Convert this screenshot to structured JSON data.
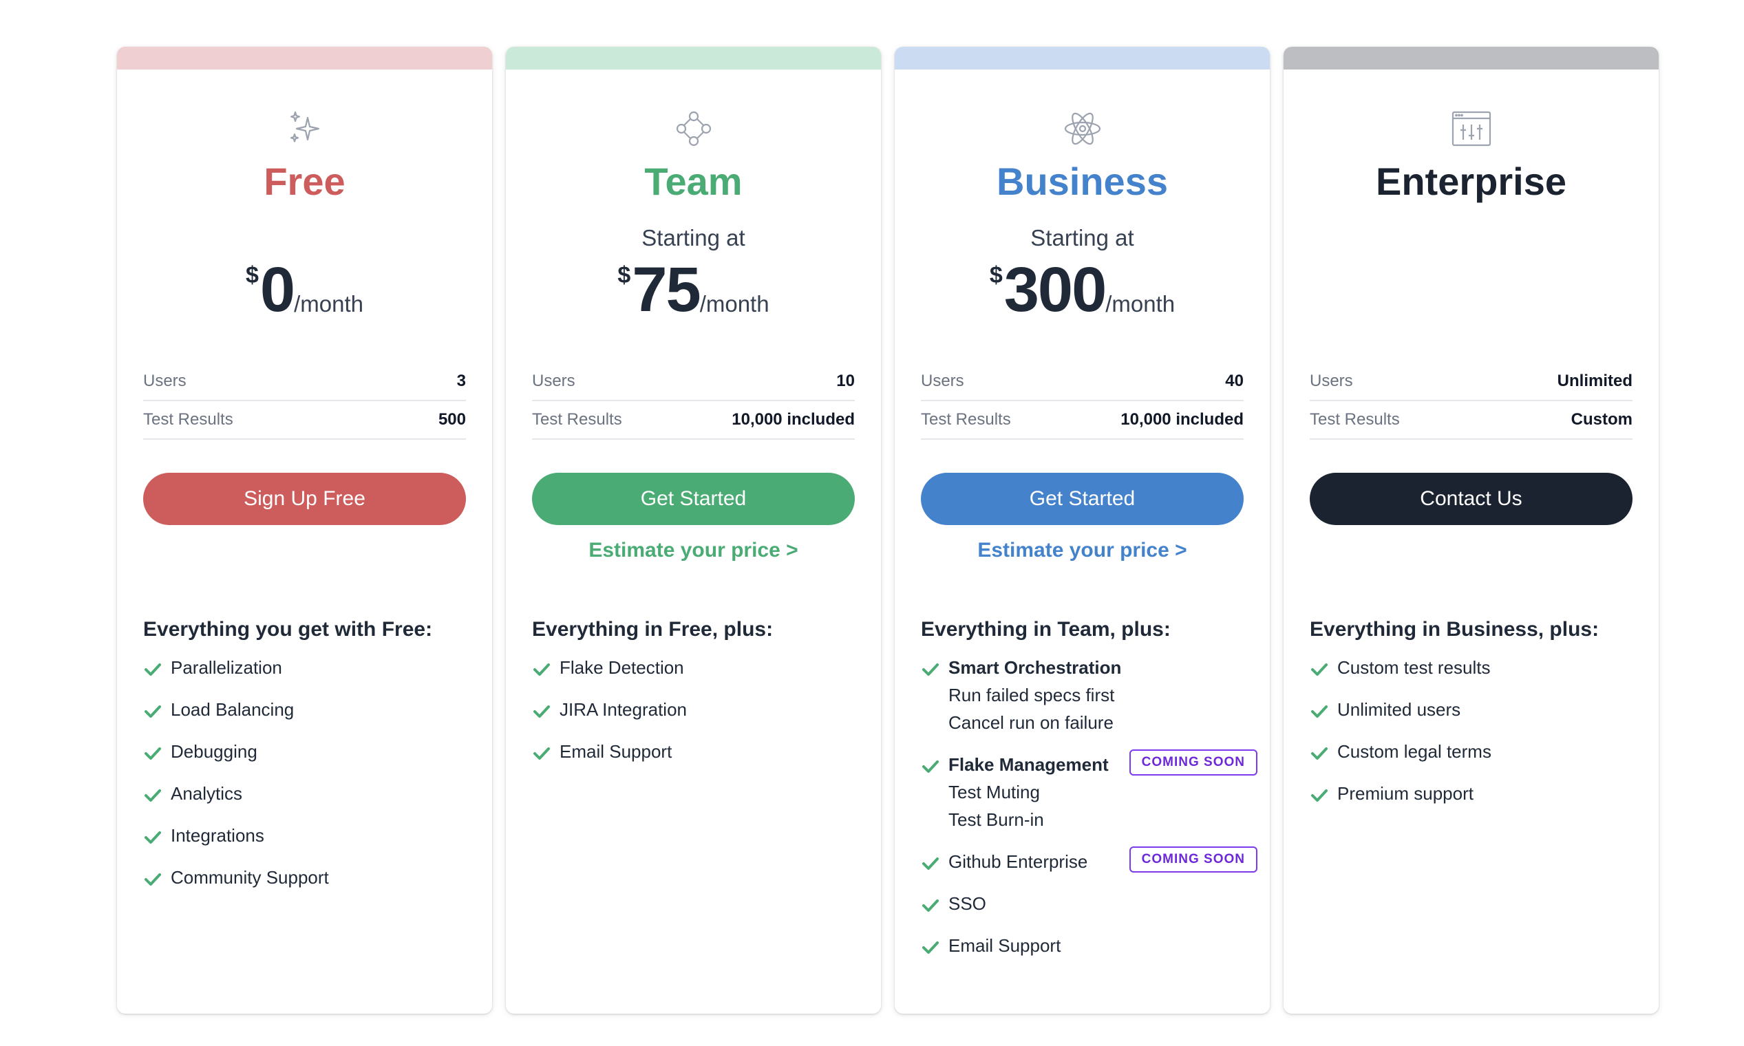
{
  "plans": [
    {
      "name": "Free",
      "color": "#cd5c5c",
      "bar_color": "#f0cfd2",
      "icon": "sparkles-icon",
      "starting": "",
      "currency": "$",
      "amount": "0",
      "period": "/month",
      "stats": [
        {
          "label": "Users",
          "value": "3"
        },
        {
          "label": "Test Results",
          "value": "500"
        }
      ],
      "cta": "Sign Up Free",
      "estimate": "",
      "features_title": "Everything you get with Free:",
      "features": [
        {
          "text": "Parallelization"
        },
        {
          "text": "Load Balancing"
        },
        {
          "text": "Debugging"
        },
        {
          "text": "Analytics"
        },
        {
          "text": "Integrations"
        },
        {
          "text": "Community Support"
        }
      ]
    },
    {
      "name": "Team",
      "color": "#4aab74",
      "bar_color": "#cbe9d9",
      "icon": "network-nodes-icon",
      "starting": "Starting at",
      "currency": "$",
      "amount": "75",
      "period": "/month",
      "stats": [
        {
          "label": "Users",
          "value": "10"
        },
        {
          "label": "Test Results",
          "value": "10,000 included"
        }
      ],
      "cta": "Get Started",
      "estimate": "Estimate your price >",
      "features_title": "Everything in Free, plus:",
      "features": [
        {
          "text": "Flake Detection"
        },
        {
          "text": "JIRA Integration"
        },
        {
          "text": "Email Support"
        }
      ]
    },
    {
      "name": "Business",
      "color": "#4483cc",
      "bar_color": "#cbdcf2",
      "icon": "atom-icon",
      "starting": "Starting at",
      "currency": "$",
      "amount": "300",
      "period": "/month",
      "stats": [
        {
          "label": "Users",
          "value": "40"
        },
        {
          "label": "Test Results",
          "value": "10,000 included"
        }
      ],
      "cta": "Get Started",
      "estimate": "Estimate your price >",
      "features_title": "Everything in Team, plus:",
      "features": [
        {
          "bold": "Smart Orchestration",
          "subs": [
            "Run failed specs first",
            "Cancel run on failure"
          ]
        },
        {
          "bold": "Flake Management",
          "subs": [
            "Test Muting",
            "Test Burn-in"
          ],
          "badge": "COMING SOON"
        },
        {
          "text": "Github Enterprise",
          "badge": "COMING SOON"
        },
        {
          "text": "SSO"
        },
        {
          "text": "Email Support"
        }
      ]
    },
    {
      "name": "Enterprise",
      "color": "#1b2330",
      "bar_color": "#bcbec2",
      "icon": "control-panel-icon",
      "starting": "",
      "currency": "",
      "amount": "",
      "period": "",
      "stats": [
        {
          "label": "Users",
          "value": "Unlimited"
        },
        {
          "label": "Test Results",
          "value": "Custom"
        }
      ],
      "cta": "Contact Us",
      "estimate": "",
      "features_title": "Everything in Business, plus:",
      "features": [
        {
          "text": "Custom test results"
        },
        {
          "text": "Unlimited users"
        },
        {
          "text": "Custom legal terms"
        },
        {
          "text": "Premium support"
        }
      ]
    }
  ],
  "check_color": "#4aab74"
}
